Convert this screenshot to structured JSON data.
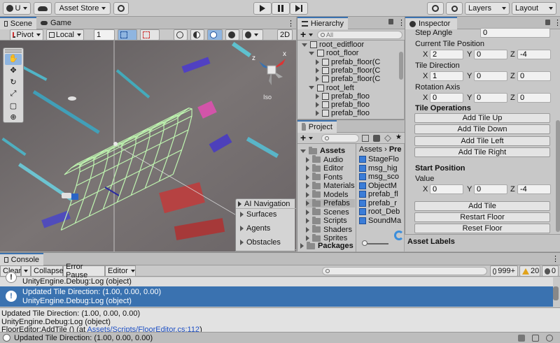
{
  "toolbar": {
    "account_label": "U",
    "asset_store_label": "Asset Store",
    "layers_label": "Layers",
    "layout_label": "Layout"
  },
  "scene": {
    "tab_scene": "Scene",
    "tab_game": "Game",
    "pivot_label": "Pivot",
    "local_label": "Local",
    "snap_value": "1",
    "mode_2d": "2D",
    "iso_label": "Iso",
    "gizmo_x": "x",
    "gizmo_z": "z",
    "ai_nav": {
      "title": "AI Navigation",
      "items": [
        "Surfaces",
        "Agents",
        "Obstacles"
      ]
    }
  },
  "hierarchy": {
    "tab": "Hierarchy",
    "search_placeholder": "All",
    "rows": [
      {
        "label": "root_editfloor",
        "indent": 0
      },
      {
        "label": "root_floor",
        "indent": 1
      },
      {
        "label": "prefab_floor(C",
        "indent": 2
      },
      {
        "label": "prefab_floor(C",
        "indent": 2
      },
      {
        "label": "prefab_floor(C",
        "indent": 2
      },
      {
        "label": "root_left",
        "indent": 1
      },
      {
        "label": "prefab_floo",
        "indent": 2
      },
      {
        "label": "prefab_floo",
        "indent": 2
      },
      {
        "label": "prefab_floo",
        "indent": 2
      }
    ]
  },
  "project": {
    "tab": "Project",
    "tree": [
      "Assets",
      "Audio",
      "Editor",
      "Fonts",
      "Materials",
      "Models",
      "Prefabs",
      "Scenes",
      "Scripts",
      "Shaders",
      "Sprites",
      "Packages"
    ],
    "breadcrumb_root": "Assets",
    "breadcrumb_sep": "›",
    "breadcrumb_child": "Pre",
    "files": [
      "StageFlo",
      "msg_hig",
      "msg_sco",
      "ObjectM",
      "prefab_fl",
      "prefab_r",
      "root_Deb",
      "SoundMa"
    ]
  },
  "inspector": {
    "tab": "Inspector",
    "step_angle_label": "Step Angle",
    "step_angle_value": "0",
    "current_tile_position_label": "Current Tile Position",
    "current_tile_position": {
      "x": "2",
      "y": "0",
      "z": "-4"
    },
    "tile_direction_label": "Tile Direction",
    "tile_direction": {
      "x": "1",
      "y": "0",
      "z": "0"
    },
    "rotation_axis_label": "Rotation Axis",
    "rotation_axis": {
      "x": "0",
      "y": "0",
      "z": "0"
    },
    "axis_x": "X",
    "axis_y": "Y",
    "axis_z": "Z",
    "tile_operations_label": "Tile Operations",
    "ops_buttons": [
      "Add Tile Up",
      "Add Tile Down",
      "Add Tile Left",
      "Add Tile Right"
    ],
    "start_position_label": "Start Position",
    "value_label": "Value",
    "start_value": {
      "x": "0",
      "y": "0",
      "z": "-4"
    },
    "action_buttons": [
      "Add Tile",
      "Restart Floor",
      "Reset Floor"
    ],
    "asset_labels": "Asset Labels"
  },
  "console": {
    "tab": "Console",
    "clear": "Clear",
    "collapse": "Collapse",
    "error_pause": "Error Pause",
    "editor": "Editor",
    "count_info": "999+",
    "count_warn": "20",
    "count_error": "0",
    "entries": [
      {
        "line1": "",
        "line2": "UnityEngine.Debug:Log (object)",
        "selected": false
      },
      {
        "line1": "Updated Tile Direction: (1.00, 0.00, 0.00)",
        "line2": "UnityEngine.Debug:Log (object)",
        "selected": true
      }
    ],
    "detail": [
      "Updated Tile Direction: (1.00, 0.00, 0.00)",
      "UnityEngine.Debug:Log (object)"
    ],
    "detail_trace_prefix": "FloorEditor:AddTile () (at ",
    "detail_trace_link": "Assets/Scripts/FloorEditor.cs:112",
    "detail_trace_suffix": ")"
  },
  "status_bar": {
    "message": "Updated Tile Direction: (1.00, 0.00, 0.00)"
  },
  "colors": {
    "accent": "#3a72b0",
    "selection": "#3a72b0",
    "scene_bg": "#6f6a6a",
    "grid": "#bff5b0"
  }
}
